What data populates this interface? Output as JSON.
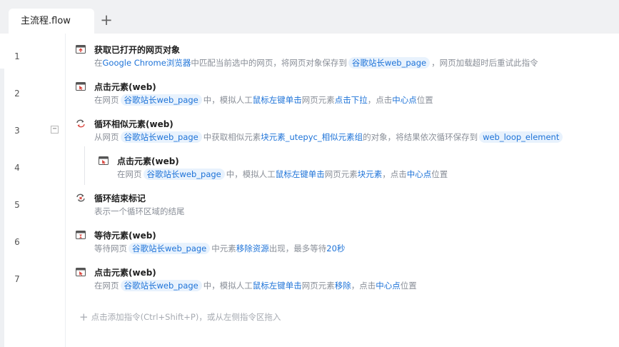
{
  "tabs": [
    {
      "label": "主流程.flow"
    }
  ],
  "tab_add_label": "+",
  "collapse_label": "−",
  "lines": [
    {
      "no": "1",
      "title": "获取已打开的网页对象",
      "d": [
        "在",
        "Google Chrome浏览器",
        "中匹配当前选中的网页，将网页对象保存到",
        "谷歌站长web_page",
        "，网页加载超时后重试此指令"
      ]
    },
    {
      "no": "2",
      "title": "点击元素(web)",
      "d": [
        "在网页",
        "谷歌站长web_page",
        "中，模拟人工",
        "鼠标左键单击",
        "网页元素",
        "点击下拉",
        "，点击",
        "中心点",
        "位置"
      ]
    },
    {
      "no": "3",
      "title": "循环相似元素(web)",
      "d": [
        "从网页",
        "谷歌站长web_page",
        "中获取相似元素",
        "块元素_utepyc_相似元素组",
        "的对象，将结果依次循环保存到",
        "web_loop_element"
      ]
    },
    {
      "no": "4",
      "title": "点击元素(web)",
      "d": [
        "在网页",
        "谷歌站长web_page",
        "中，模拟人工",
        "鼠标左键单击",
        "网页元素",
        "块元素",
        "，点击",
        "中心点",
        "位置"
      ]
    },
    {
      "no": "5",
      "title": "循环结束标记",
      "d": [
        "表示一个循环区域的结尾"
      ]
    },
    {
      "no": "6",
      "title": "等待元素(web)",
      "d": [
        "等待网页",
        "谷歌站长web_page",
        "中元素",
        "移除资源",
        "出现，最多等待",
        "20秒"
      ]
    },
    {
      "no": "7",
      "title": "点击元素(web)",
      "d": [
        "在网页",
        "谷歌站长web_page",
        "中，模拟人工",
        "鼠标左键单击",
        "网页元素",
        "移除",
        "，点击",
        "中心点",
        "位置"
      ]
    }
  ],
  "add_hint": "点击添加指令(Ctrl+Shift+P)，或从左侧指令区拖入",
  "add_hint_plus": "+",
  "colors": {
    "accent": "#1e73d8",
    "pill_bg": "#e8f2fd",
    "icon_red": "#d9453d"
  }
}
